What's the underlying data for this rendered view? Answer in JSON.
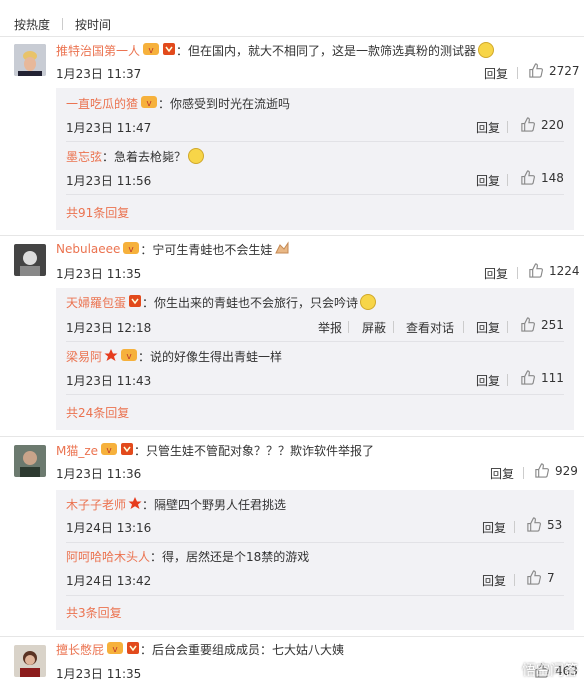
{
  "sort": {
    "hot": "按热度",
    "time": "按时间"
  },
  "reply_label": "回复",
  "actions": {
    "report": "举报",
    "block": "屏蔽",
    "view_thread": "查看对话"
  },
  "comments": [
    {
      "user": "推特治国第一人",
      "text": "：但在国内，就大不相同了，这是一款筛选真粉的测试器",
      "time": "1月23日 11:37",
      "likes": "2727",
      "replies": [
        {
          "user": "一直吃瓜的猹",
          "text": "：你感受到时光在流逝吗",
          "time": "1月23日 11:47",
          "likes": "220"
        },
        {
          "user": "墨忘弦",
          "text": "：急着去枪毙？",
          "time": "1月23日 11:56",
          "likes": "148"
        }
      ],
      "more": "共91条回复"
    },
    {
      "user": "Nebulaeee",
      "text": "：宁可生青蛙也不会生娃",
      "time": "1月23日 11:35",
      "likes": "1224",
      "replies": [
        {
          "user": "天婦羅包蛋",
          "text": "：你生出来的青蛙也不会旅行，只会吟诗",
          "time": "1月23日 12:18",
          "likes": "251"
        },
        {
          "user": "梁易阿",
          "text": "：说的好像生得出青蛙一样",
          "time": "1月23日 11:43",
          "likes": "111"
        }
      ],
      "more": "共24条回复"
    },
    {
      "user": "M猫_ze",
      "text": "：只管生娃不管配对象？？？欺诈软件举报了",
      "time": "1月23日 11:36",
      "likes": "929",
      "replies": [
        {
          "user": "木子子老师",
          "text": "：隔壁四个野男人任君挑选",
          "time": "1月24日 13:16",
          "likes": "53"
        },
        {
          "user": "阿呵哈哈木头人",
          "text": "：得，居然还是个18禁的游戏",
          "time": "1月24日 13:42",
          "likes": "7"
        }
      ],
      "more": "共3条回复"
    },
    {
      "user": "擅长憋屁",
      "text": "：后台会重要组成成员：七大姑八大姨",
      "time": "1月23日 11:35",
      "likes": "463"
    }
  ],
  "watermark": "悟空问答",
  "colors": {
    "username": "#eb7350",
    "subbox": "#f2f2f5"
  }
}
